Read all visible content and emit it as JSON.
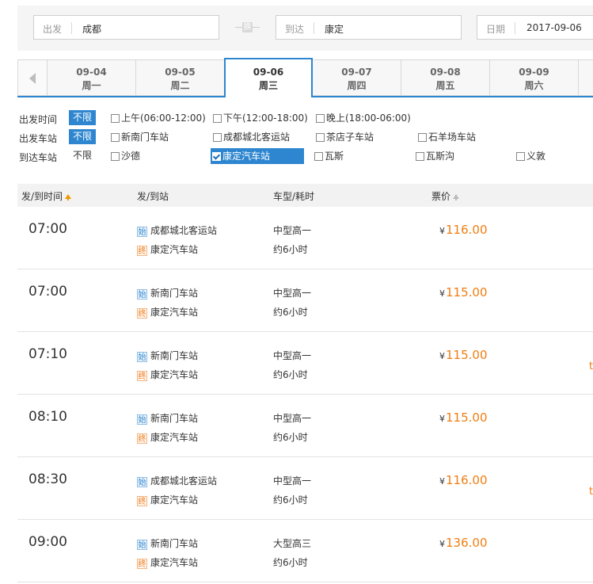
{
  "search": {
    "from_label": "出发",
    "from_value": "成都",
    "swap_label": "换",
    "to_label": "到达",
    "to_value": "康定",
    "date_label": "日期",
    "date_value": "2017-09-06"
  },
  "date_tabs": [
    {
      "date": "09-04",
      "weekday": "周一",
      "active": false
    },
    {
      "date": "09-05",
      "weekday": "周二",
      "active": false
    },
    {
      "date": "09-06",
      "weekday": "周三",
      "active": true
    },
    {
      "date": "09-07",
      "weekday": "周四",
      "active": false
    },
    {
      "date": "09-08",
      "weekday": "周五",
      "active": false
    },
    {
      "date": "09-09",
      "weekday": "周六",
      "active": false
    }
  ],
  "filters": {
    "depart_time": {
      "label": "出发时间",
      "all": "不限",
      "options": [
        "上午(06:00-12:00)",
        "下午(12:00-18:00)",
        "晚上(18:00-06:00)"
      ]
    },
    "depart_station": {
      "label": "出发车站",
      "all": "不限",
      "options": [
        "新南门车站",
        "成都城北客运站",
        "茶店子车站",
        "石羊场车站"
      ]
    },
    "arrive_station": {
      "label": "到达车站",
      "all": "不限",
      "options": [
        "沙德",
        "康定汽车站",
        "瓦斯",
        "瓦斯沟",
        "义敦"
      ],
      "checked": "康定汽车站"
    }
  },
  "table": {
    "headers": {
      "time": "发/到时间",
      "station": "发/到站",
      "bus": "车型/耗时",
      "price": "票价"
    },
    "currency": "¥",
    "start_badge": "始",
    "end_badge": "终",
    "rows": [
      {
        "time": "07:00",
        "from": "成都城北客运站",
        "to": "康定汽车站",
        "bus_type": "中型高一",
        "duration": "约6小时",
        "price": "116.00",
        "edge": ""
      },
      {
        "time": "07:00",
        "from": "新南门车站",
        "to": "康定汽车站",
        "bus_type": "中型高一",
        "duration": "约6小时",
        "price": "115.00",
        "edge": ""
      },
      {
        "time": "07:10",
        "from": "新南门车站",
        "to": "康定汽车站",
        "bus_type": "中型高一",
        "duration": "约6小时",
        "price": "115.00",
        "edge": "ti"
      },
      {
        "time": "08:10",
        "from": "新南门车站",
        "to": "康定汽车站",
        "bus_type": "中型高一",
        "duration": "约6小时",
        "price": "115.00",
        "edge": ""
      },
      {
        "time": "08:30",
        "from": "成都城北客运站",
        "to": "康定汽车站",
        "bus_type": "中型高一",
        "duration": "约6小时",
        "price": "116.00",
        "edge": "ti"
      },
      {
        "time": "09:00",
        "from": "新南门车站",
        "to": "康定汽车站",
        "bus_type": "大型高三",
        "duration": "约6小时",
        "price": "136.00",
        "edge": ""
      }
    ]
  },
  "colors": {
    "accent": "#2d86cf",
    "price": "#f07d11",
    "sort_active": "#f39800"
  }
}
